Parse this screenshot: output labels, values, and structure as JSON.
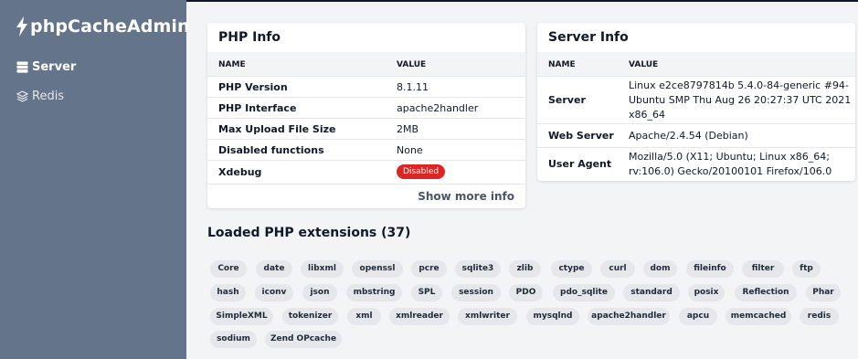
{
  "app": {
    "title": "phpCacheAdmin"
  },
  "sidebar": {
    "items": [
      {
        "label": "Server",
        "icon": "server-icon"
      },
      {
        "label": "Redis",
        "icon": "layers-icon"
      }
    ]
  },
  "php_info": {
    "title": "PHP Info",
    "col_name": "NAME",
    "col_value": "VALUE",
    "rows": [
      {
        "name": "PHP Version",
        "value": "8.1.11"
      },
      {
        "name": "PHP Interface",
        "value": "apache2handler"
      },
      {
        "name": "Max Upload File Size",
        "value": "2MB"
      },
      {
        "name": "Disabled functions",
        "value": "None"
      },
      {
        "name": "Xdebug",
        "value": "Disabled"
      }
    ],
    "show_more": "Show more info"
  },
  "server_info": {
    "title": "Server Info",
    "col_name": "NAME",
    "col_value": "VALUE",
    "rows": [
      {
        "name": "Server",
        "value_lines": [
          "Linux e2ce8797814b 5.4.0-84-generic #94-",
          "Ubuntu SMP Thu Aug 26 20:27:37 UTC 2021",
          "x86_64"
        ]
      },
      {
        "name": "Web Server",
        "value_lines": [
          "Apache/2.4.54 (Debian)"
        ]
      },
      {
        "name": "User Agent",
        "value_lines": [
          "Mozilla/5.0 (X11; Ubuntu; Linux x86_64;",
          "rv:106.0) Gecko/20100101 Firefox/106.0"
        ]
      }
    ]
  },
  "extensions": {
    "title": "Loaded PHP extensions (37)",
    "items": [
      "Core",
      "date",
      "libxml",
      "openssl",
      "pcre",
      "sqlite3",
      "zlib",
      "ctype",
      "curl",
      "dom",
      "fileinfo",
      "filter",
      "ftp",
      "hash",
      "iconv",
      "json",
      "mbstring",
      "SPL",
      "session",
      "PDO",
      "pdo_sqlite",
      "standard",
      "posix",
      "Reflection",
      "Phar",
      "SimpleXML",
      "tokenizer",
      "xml",
      "xmlreader",
      "xmlwriter",
      "mysqlnd",
      "apache2handler",
      "apcu",
      "memcached",
      "redis",
      "sodium",
      "Zend OPcache"
    ]
  },
  "colors": {
    "sidebar": "#64748b",
    "badge_disabled": "#dc2626",
    "pill_bg": "#e5e7eb"
  }
}
